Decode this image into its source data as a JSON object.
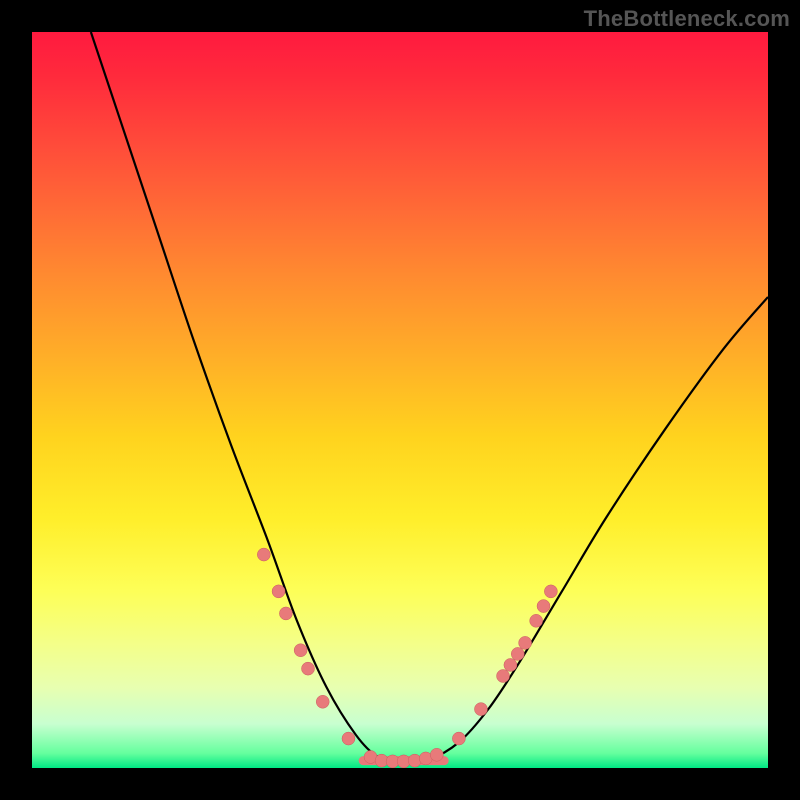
{
  "attribution": "TheBottleneck.com",
  "colors": {
    "frame": "#000000",
    "curve_stroke": "#000000",
    "marker_fill": "#e87a7a",
    "marker_stroke": "#c95e5e",
    "gradient_top": "#ff1a3f",
    "gradient_bottom": "#00e884"
  },
  "chart_data": {
    "type": "line",
    "title": "",
    "xlabel": "",
    "ylabel": "",
    "xlim": [
      0,
      100
    ],
    "ylim": [
      0,
      100
    ],
    "series": [
      {
        "name": "bottleneck-curve",
        "points": [
          {
            "x": 8,
            "y": 100
          },
          {
            "x": 12,
            "y": 88
          },
          {
            "x": 17,
            "y": 73
          },
          {
            "x": 22,
            "y": 58
          },
          {
            "x": 27,
            "y": 44
          },
          {
            "x": 32,
            "y": 31
          },
          {
            "x": 36,
            "y": 20
          },
          {
            "x": 40,
            "y": 11
          },
          {
            "x": 44,
            "y": 4.5
          },
          {
            "x": 47,
            "y": 1.5
          },
          {
            "x": 50,
            "y": 0.8
          },
          {
            "x": 54,
            "y": 1.2
          },
          {
            "x": 58,
            "y": 3.5
          },
          {
            "x": 62,
            "y": 8
          },
          {
            "x": 66,
            "y": 14
          },
          {
            "x": 72,
            "y": 24
          },
          {
            "x": 78,
            "y": 34
          },
          {
            "x": 86,
            "y": 46
          },
          {
            "x": 94,
            "y": 57
          },
          {
            "x": 100,
            "y": 64
          }
        ]
      }
    ],
    "markers": [
      {
        "x": 31.5,
        "y": 29
      },
      {
        "x": 33.5,
        "y": 24
      },
      {
        "x": 34.5,
        "y": 21
      },
      {
        "x": 36.5,
        "y": 16
      },
      {
        "x": 37.5,
        "y": 13.5
      },
      {
        "x": 39.5,
        "y": 9
      },
      {
        "x": 43,
        "y": 4
      },
      {
        "x": 46,
        "y": 1.5
      },
      {
        "x": 47.5,
        "y": 1.0
      },
      {
        "x": 49,
        "y": 0.9
      },
      {
        "x": 50.5,
        "y": 0.9
      },
      {
        "x": 52,
        "y": 1.0
      },
      {
        "x": 53.5,
        "y": 1.3
      },
      {
        "x": 55,
        "y": 1.8
      },
      {
        "x": 58,
        "y": 4
      },
      {
        "x": 61,
        "y": 8
      },
      {
        "x": 64,
        "y": 12.5
      },
      {
        "x": 65,
        "y": 14
      },
      {
        "x": 66,
        "y": 15.5
      },
      {
        "x": 67,
        "y": 17
      },
      {
        "x": 68.5,
        "y": 20
      },
      {
        "x": 69.5,
        "y": 22
      },
      {
        "x": 70.5,
        "y": 24
      }
    ],
    "flat_segment": {
      "x0": 45,
      "x1": 56,
      "y": 1.0,
      "thickness": 9
    }
  }
}
